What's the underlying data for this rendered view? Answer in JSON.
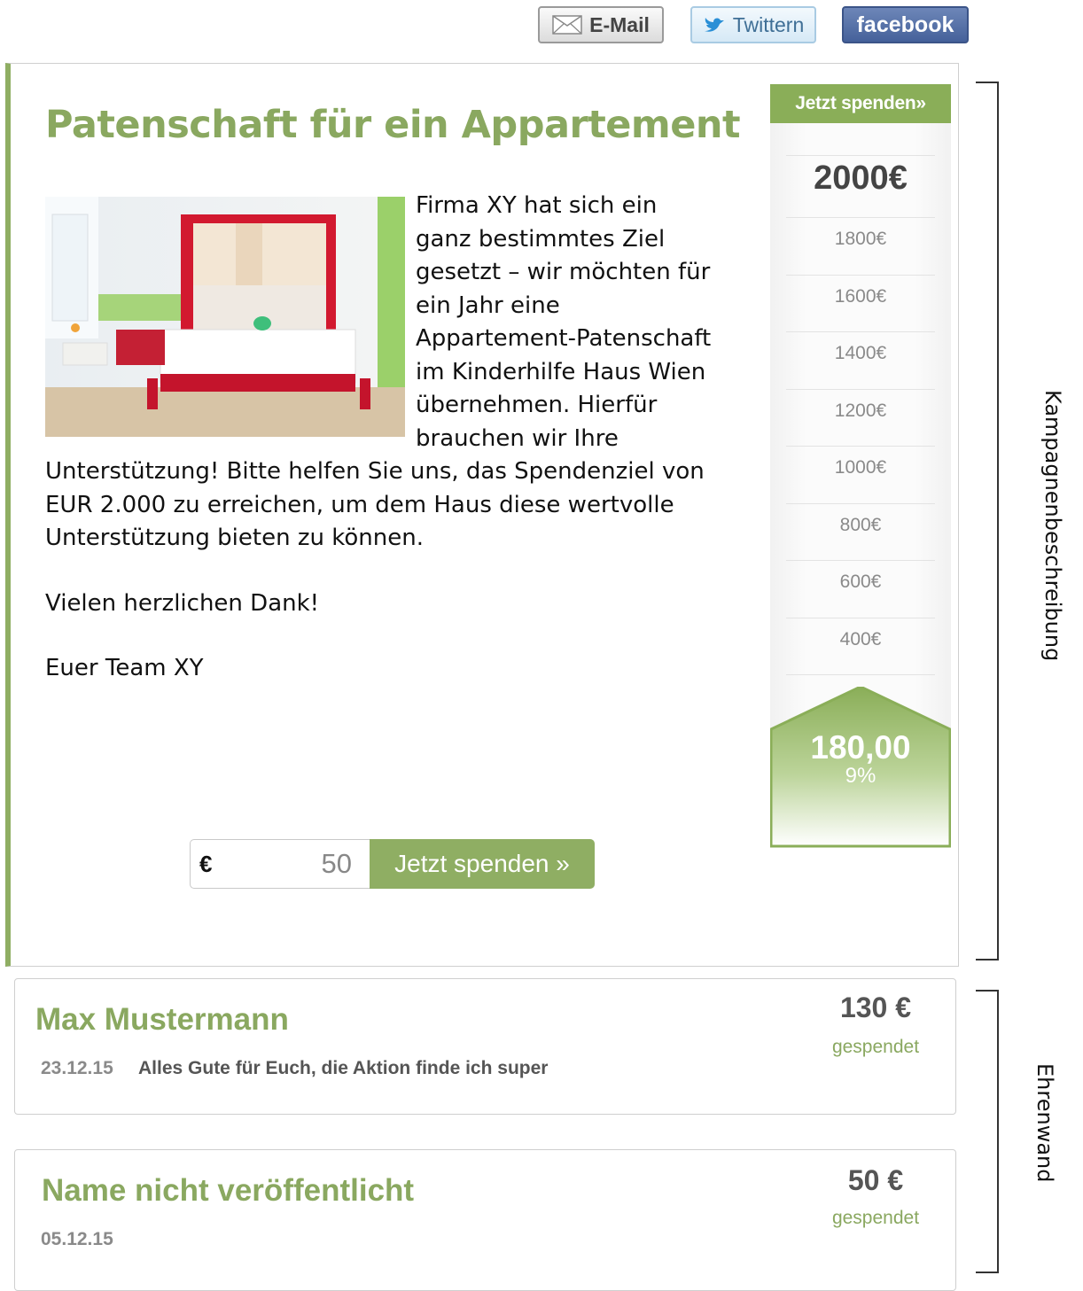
{
  "share": {
    "email_label": "E-Mail",
    "twitter_label": "Twittern",
    "facebook_label": "facebook"
  },
  "campaign": {
    "title": "Patenschaft für ein Appartement",
    "description": "Firma XY hat sich ein ganz bestimmtes Ziel gesetzt – wir möchten für ein Jahr eine Appartement-Patenschaft im Kinderhilfe Haus Wien übernehmen. Hierfür brauchen wir Ihre Unterstützung! Bitte helfen Sie uns, das Spendenziel von EUR 2.000 zu erreichen, um dem Haus diese wertvolle Unterstützung bieten zu können.",
    "thanks": "Vielen herzlichen Dank!",
    "signature": "Euer Team XY",
    "donate_form": {
      "currency": "€",
      "amount": "50",
      "button_label": "Jetzt spenden »"
    }
  },
  "thermometer": {
    "header_label": "Jetzt spenden»",
    "goal": "2000€",
    "ticks": [
      "1800€",
      "1600€",
      "1400€",
      "1200€",
      "1000€",
      "800€",
      "600€",
      "400€"
    ],
    "raised": "180,00",
    "percent": "9%",
    "fill_fraction": 0.09,
    "accent_color": "#8aae58"
  },
  "side_labels": {
    "campaign": "Kampagnenbeschreibung",
    "wall": "Ehrenwand"
  },
  "donations": [
    {
      "name": "Max Mustermann",
      "date": "23.12.15",
      "message": "Alles Gute für Euch, die Aktion finde ich super",
      "amount": "130 €",
      "status": "gespendet"
    },
    {
      "name": "Name nicht veröffentlicht",
      "date": "05.12.15",
      "message": "",
      "amount": "50 €",
      "status": "gespendet"
    }
  ],
  "icons": {
    "email": "envelope-icon",
    "twitter": "bird-icon"
  }
}
